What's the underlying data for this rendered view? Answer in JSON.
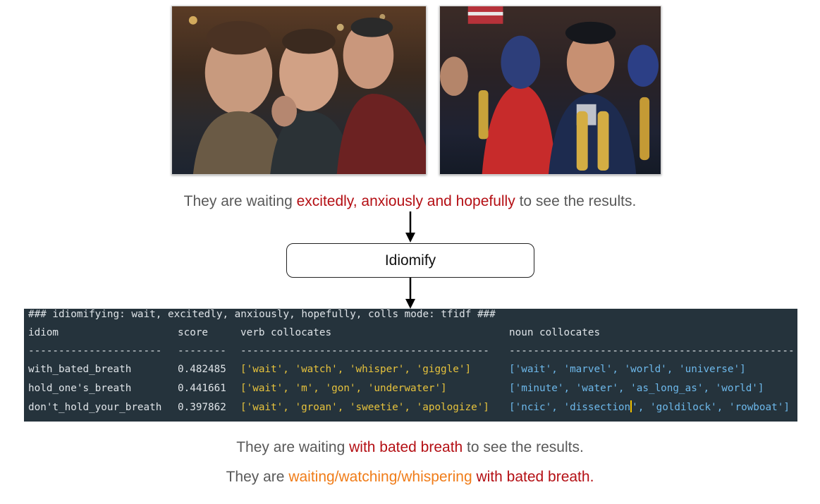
{
  "sentences": {
    "input": {
      "prefix": "They are waiting ",
      "highlight": "excitedly, anxiously and hopefully",
      "suffix": " to see the results."
    },
    "output_1": {
      "prefix": "They are waiting ",
      "highlight": "with bated breath",
      "suffix": " to see the results."
    },
    "output_2": {
      "prefix": "They are ",
      "highlight_orange": "waiting/watching/whispering",
      "highlight_red": " with bated breath."
    }
  },
  "process_box": {
    "label": "Idiomify"
  },
  "terminal": {
    "header": "### idiomifying: wait, excitedly, anxiously, hopefully, colls mode: tfidf ###",
    "columns": {
      "idiom": "idiom",
      "score": "score",
      "verb": "verb collocates",
      "noun": "noun collocates"
    },
    "dashes": {
      "idiom": "----------------------",
      "score": "--------",
      "verb": "-----------------------------------------",
      "noun": "-----------------------------------------------"
    },
    "rows": [
      {
        "idiom": "with_bated_breath",
        "score": "0.482485",
        "verb": "['wait', 'watch', 'whisper', 'giggle']",
        "noun": "['wait', 'marvel', 'world', 'universe']"
      },
      {
        "idiom": "hold_one's_breath",
        "score": "0.441661",
        "verb": "['wait', 'm', 'gon', 'underwater']",
        "noun": "['minute', 'water', 'as_long_as', 'world']"
      },
      {
        "idiom": "don't_hold_your_breath",
        "score": "0.397862",
        "verb": "['wait', 'groan', 'sweetie', 'apologize']",
        "noun_before_cursor": "['ncic', 'dissection",
        "noun_after_cursor": "', 'goldilock', 'rowboat']"
      }
    ]
  },
  "colors": {
    "highlight_red": "#b40f14",
    "highlight_orange": "#f07c18",
    "terminal_bg": "#25333c",
    "verb_collocates": "#e6c23c",
    "noun_collocates": "#6db8ea"
  }
}
